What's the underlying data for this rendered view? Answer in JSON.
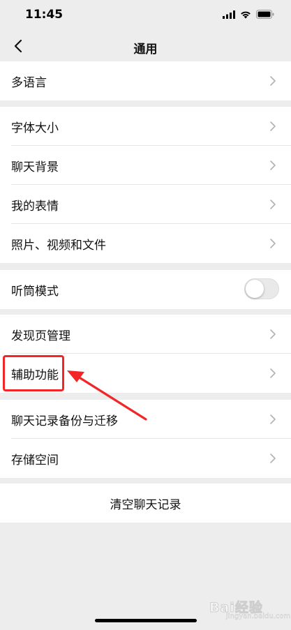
{
  "status_bar": {
    "time": "11:45"
  },
  "nav": {
    "title": "通用"
  },
  "groups": [
    {
      "rows": [
        {
          "label": "多语言"
        }
      ]
    },
    {
      "rows": [
        {
          "label": "字体大小"
        },
        {
          "label": "聊天背景"
        },
        {
          "label": "我的表情"
        },
        {
          "label": "照片、视频和文件"
        }
      ]
    },
    {
      "rows": [
        {
          "label": "听筒模式",
          "toggle": false
        }
      ]
    },
    {
      "rows": [
        {
          "label": "发现页管理"
        },
        {
          "label": "辅助功能"
        }
      ]
    },
    {
      "rows": [
        {
          "label": "聊天记录备份与迁移"
        },
        {
          "label": "存储空间"
        }
      ]
    },
    {
      "rows": [
        {
          "label": "清空聊天记录"
        }
      ]
    }
  ],
  "annotation": {
    "highlighted_item": "辅助功能",
    "color": "#f22626"
  },
  "watermark": {
    "text": "Bai经验",
    "subtext": "jingyan.baidu.com"
  }
}
